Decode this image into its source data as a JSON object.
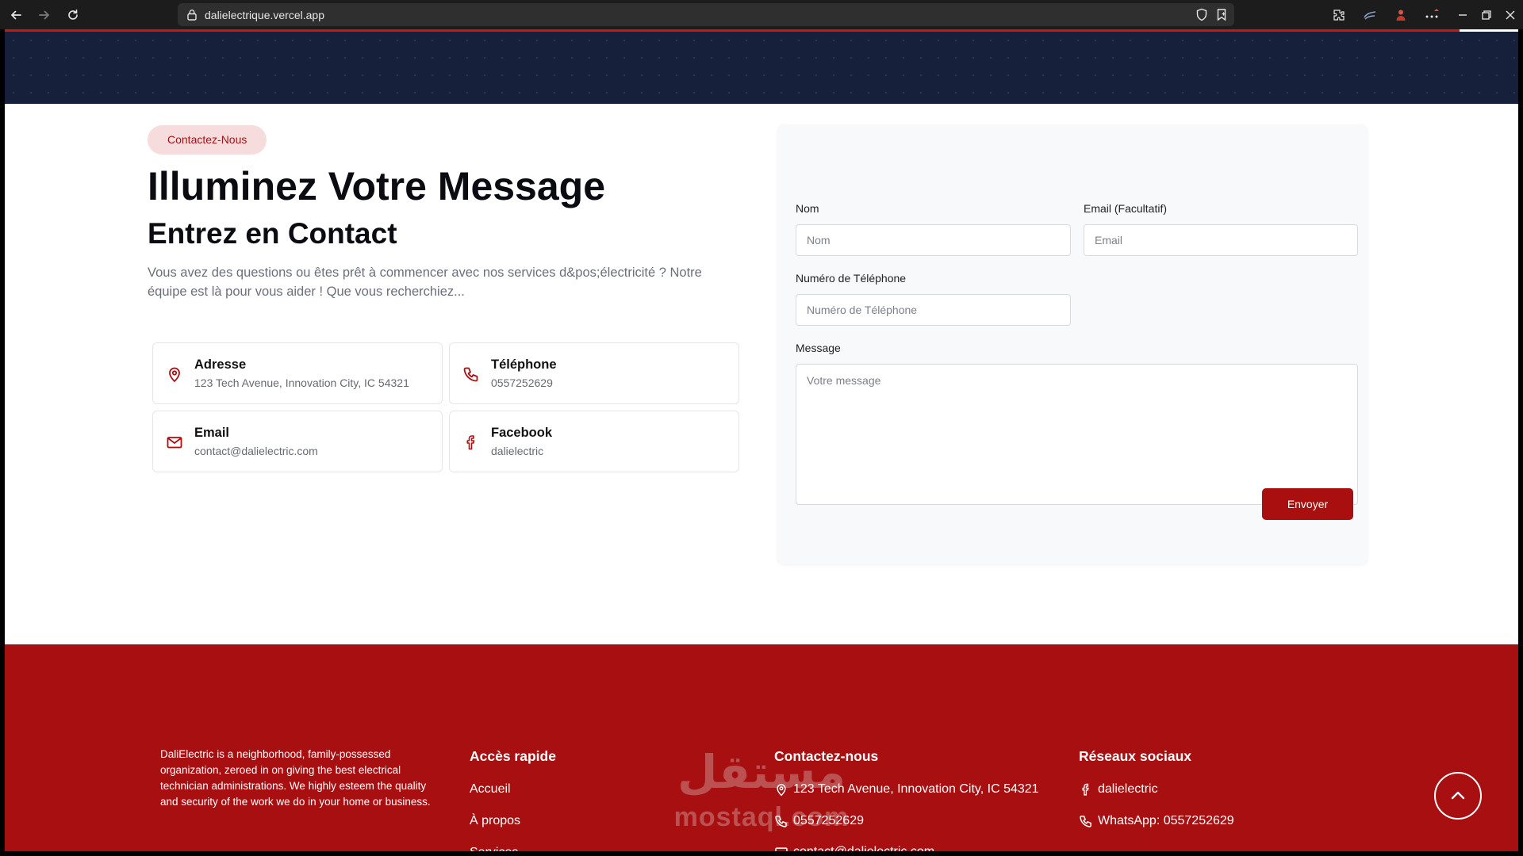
{
  "browser": {
    "url": "dalielectrique.vercel.app",
    "icons": [
      "back-arrow-icon",
      "forward-arrow-icon",
      "reload-icon",
      "lock-icon",
      "shield-icon",
      "bookmark-icon",
      "extensions-icon",
      "more-icon",
      "minimize-icon",
      "restore-icon",
      "close-icon"
    ]
  },
  "colors": {
    "primary_red": "#a80f10",
    "hero_navy": "#17203a",
    "pill_bg": "#f6dcdc"
  },
  "contact": {
    "pill": "Contactez-Nous",
    "title": "Illuminez Votre Message",
    "subtitle": "Entrez en Contact",
    "intro": "Vous avez des questions ou êtes prêt à commencer avec nos services d&pos;électricité ? Notre équipe est là pour vous aider ! Que vous recherchiez...",
    "cards": [
      {
        "icon": "map-pin-icon",
        "title": "Adresse",
        "value": "123 Tech Avenue, Innovation City, IC 54321"
      },
      {
        "icon": "phone-icon",
        "title": "Téléphone",
        "value": "0557252629"
      },
      {
        "icon": "mail-icon",
        "title": "Email",
        "value": "contact@dalielectric.com"
      },
      {
        "icon": "facebook-icon",
        "title": "Facebook",
        "value": "dalielectric"
      }
    ]
  },
  "form": {
    "name_label": "Nom",
    "name_placeholder": "Nom",
    "email_label": "Email (Facultatif)",
    "email_placeholder": "Email",
    "phone_label": "Numéro de Téléphone",
    "phone_placeholder": "Numéro de Téléphone",
    "message_label": "Message",
    "message_placeholder": "Votre message",
    "submit_label": "Envoyer"
  },
  "footer": {
    "description": "DaliElectric is a neighborhood, family-possessed organization, zeroed in on giving the best electrical technician administrations. We highly esteem the quality and security of the work we do in your home or business.",
    "quick_links_title": "Accès rapide",
    "quick_links": [
      "Accueil",
      "À propos",
      "Services"
    ],
    "contact_title": "Contactez-nous",
    "contact_address": "123 Tech Avenue, Innovation City, IC 54321",
    "contact_phone": "0557252629",
    "contact_email": "contact@dalielectric.com",
    "social_title": "Réseaux sociaux",
    "social_facebook": "dalielectric",
    "social_whatsapp": "WhatsApp: 0557252629"
  },
  "watermark": {
    "arabic": "مستقل",
    "latin": "mostaql.com"
  }
}
